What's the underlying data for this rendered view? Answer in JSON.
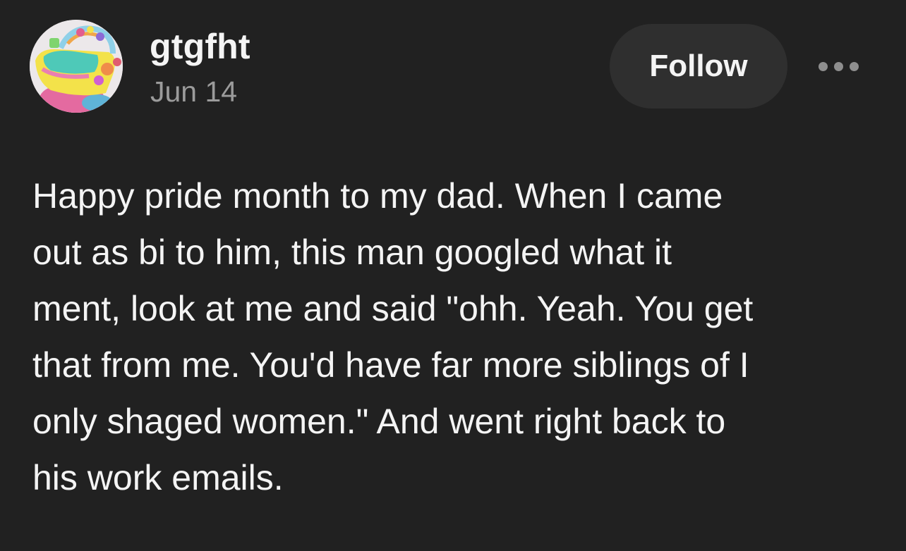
{
  "post": {
    "username": "gtgfht",
    "date": "Jun 14",
    "follow_label": "Follow",
    "more_icon": "more-horizontal-icon",
    "lines": [
      "Happy pride month to my dad. When I came",
      "out as bi to him, this man googled what it",
      "ment, look at me and said \"ohh. Yeah. You get",
      "that from me. You'd have far more siblings of I",
      "only shaged women.\" And went right back to",
      "his work emails."
    ]
  },
  "colors": {
    "background": "#212121",
    "follow_button": "#2f2f2f",
    "text": "#f4f4f4",
    "muted": "#9b9b9b"
  }
}
